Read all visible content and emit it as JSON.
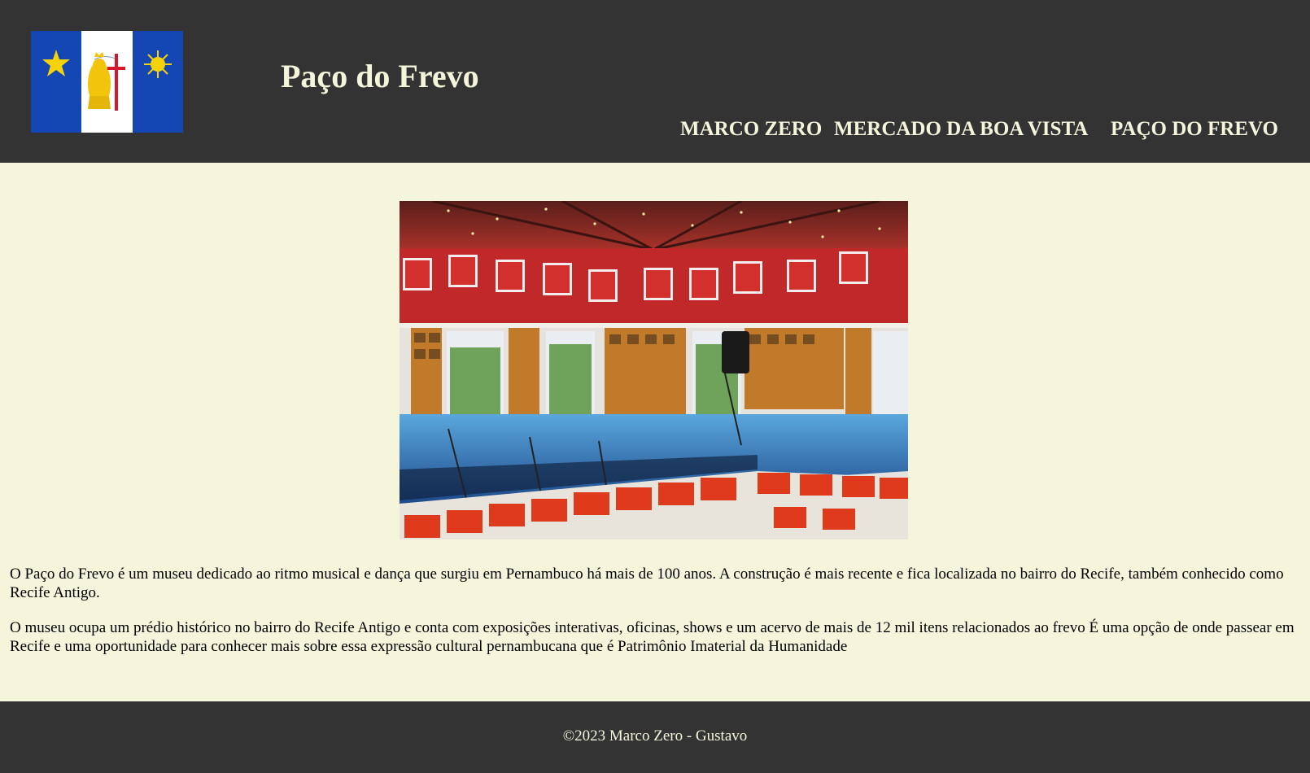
{
  "header": {
    "title": "Paço do Frevo",
    "flag_alt": "Bandeira de Pernambuco",
    "nav": [
      "MARCO ZERO",
      "MERCADO DA BOA VISTA",
      "PAÇO DO FREVO"
    ]
  },
  "main": {
    "image_alt": "Interior do Paço do Frevo",
    "paragraphs": [
      "O Paço do Frevo é um museu dedicado ao ritmo musical e dança que surgiu em Pernambuco há mais de 100 anos. A construção é mais recente e fica localizada no bairro do Recife, também conhecido como Recife Antigo.",
      "O museu ocupa um prédio histórico no bairro do Recife Antigo e conta com exposições interativas, oficinas, shows e um acervo de mais de 12 mil itens relacionados ao frevo É uma opção de onde passear em Recife e uma oportunidade para conhecer mais sobre essa expressão cultural pernambucana que é Patrimônio Imaterial da Humanidade"
    ]
  },
  "footer": {
    "text": "©2023 Marco Zero - Gustavo"
  },
  "colors": {
    "header_bg": "#333333",
    "body_bg": "#f5f5dc",
    "accent_text": "#f5f5dc"
  }
}
